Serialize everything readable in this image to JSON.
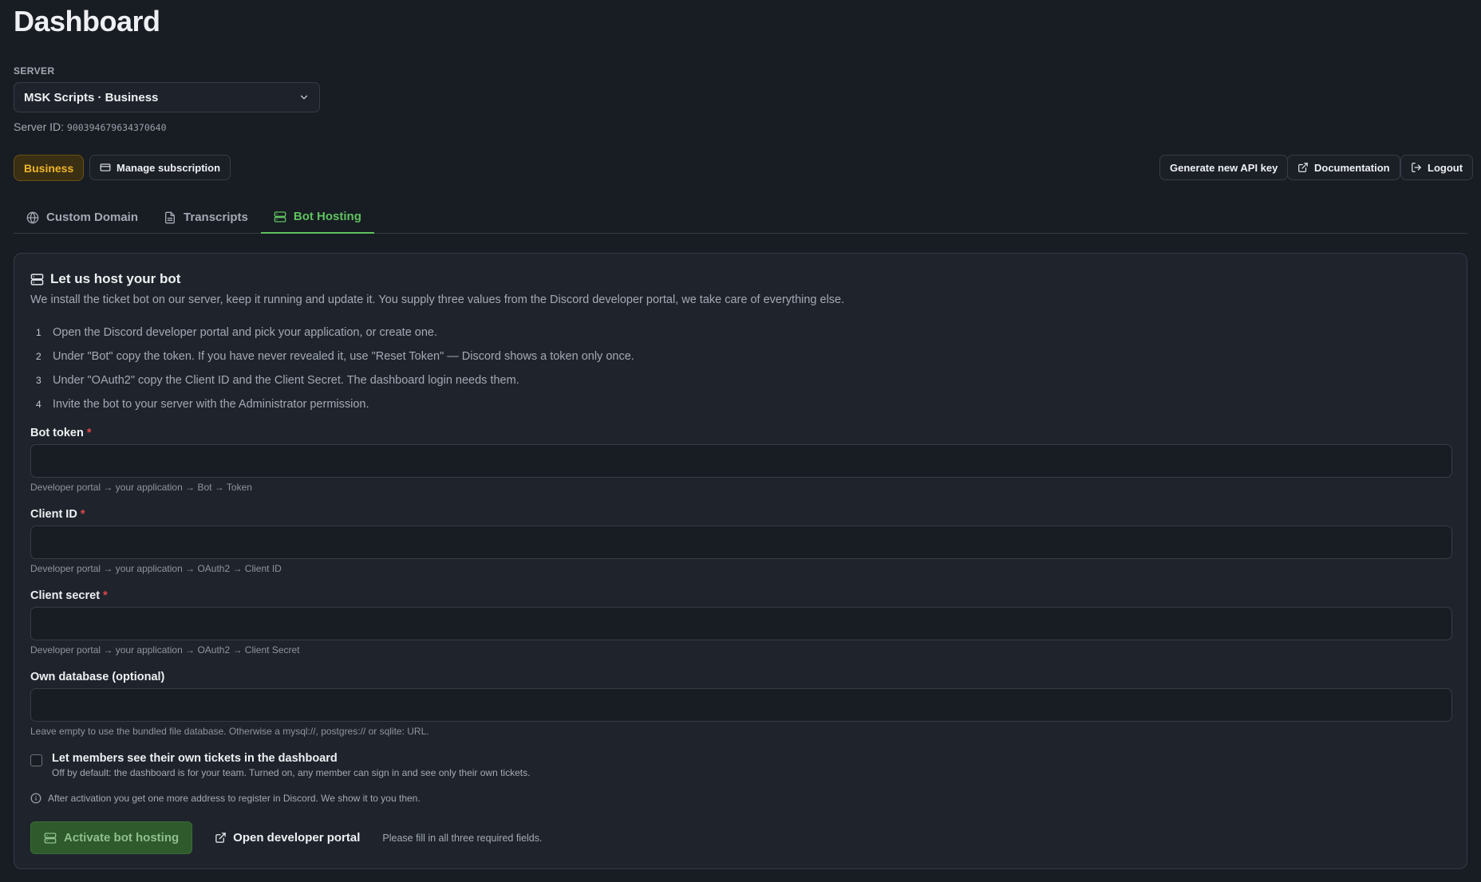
{
  "page": {
    "title": "Dashboard"
  },
  "server": {
    "label": "SERVER",
    "selected": "MSK Scripts · Business",
    "id_label": "Server ID:",
    "id_value": "900394679634370640"
  },
  "plan_badge": "Business",
  "buttons": {
    "manage_subscription": "Manage subscription",
    "generate_api_key": "Generate new API key",
    "documentation": "Documentation",
    "logout": "Logout"
  },
  "tabs": [
    {
      "label": "Custom Domain",
      "icon": "globe-icon",
      "active": false
    },
    {
      "label": "Transcripts",
      "icon": "file-text-icon",
      "active": false
    },
    {
      "label": "Bot Hosting",
      "icon": "server-icon",
      "active": true
    }
  ],
  "hosting": {
    "title": "Let us host your bot",
    "description": "We install the ticket bot on our server, keep it running and update it. You supply three values from the Discord developer portal, we take care of everything else.",
    "steps": [
      {
        "num": "1",
        "text": "Open the Discord developer portal and pick your application, or create one."
      },
      {
        "num": "2",
        "text": "Under \"Bot\" copy the token. If you have never revealed it, use \"Reset Token\" — Discord shows a token only once."
      },
      {
        "num": "3",
        "text": "Under \"OAuth2\" copy the Client ID and the Client Secret. The dashboard login needs them."
      },
      {
        "num": "4",
        "text": "Invite the bot to your server with the Administrator permission."
      }
    ],
    "fields": {
      "bot_token": {
        "label": "Bot token",
        "required_mark": "*",
        "value": "",
        "hint": "Developer portal → your application → Bot → Token"
      },
      "client_id": {
        "label": "Client ID",
        "required_mark": "*",
        "value": "",
        "hint": "Developer portal → your application → OAuth2 → Client ID"
      },
      "client_secret": {
        "label": "Client secret",
        "required_mark": "*",
        "value": "",
        "hint": "Developer portal → your application → OAuth2 → Client Secret"
      },
      "database": {
        "label": "Own database (optional)",
        "value": "",
        "hint": "Leave empty to use the bundled file database. Otherwise a mysql://, postgres:// or sqlite: URL."
      }
    },
    "member_access": {
      "checked": false,
      "title": "Let members see their own tickets in the dashboard",
      "subtitle": "Off by default: the dashboard is for your team. Turned on, any member can sign in and see only their own tickets."
    },
    "info": "After activation you get one more address to register in Discord. We show it to you then.",
    "activate_label": "Activate bot hosting",
    "portal_link": "Open developer portal",
    "fill_hint": "Please fill in all three required fields."
  },
  "colors": {
    "background": "#181c23",
    "accent_green": "#5fc25f",
    "business_gold": "#f0b52b",
    "required_red": "#e0474c"
  }
}
